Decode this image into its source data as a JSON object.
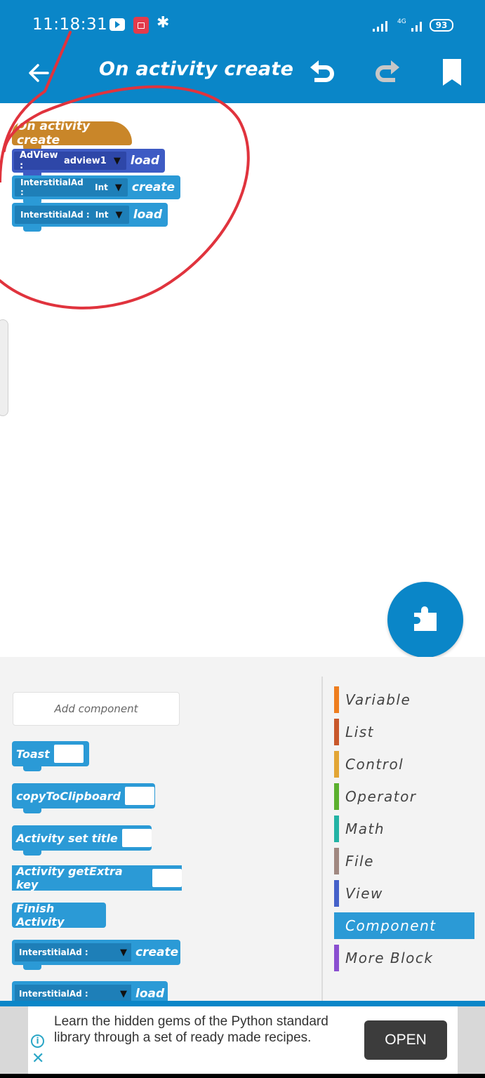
{
  "status_bar": {
    "time": "11:18:31",
    "network_label": "4G",
    "battery": "93",
    "icons": [
      "youtube-icon",
      "screen-record-icon",
      "gear-icon",
      "signal-icon",
      "signal-4g-icon",
      "battery-icon"
    ]
  },
  "app_bar": {
    "title": "On activity create",
    "back_icon": "arrow-left-icon",
    "undo_icon": "undo-icon",
    "redo_icon": "redo-icon",
    "bookmark_icon": "bookmark-icon"
  },
  "canvas": {
    "event_block": "On activity create",
    "blocks": [
      {
        "type": "AdView :",
        "selected": "adview1",
        "verb": "load",
        "color": "#3e5bc4"
      },
      {
        "type": "InterstitialAd :",
        "selected": "Int",
        "verb": "create",
        "color": "#2b9ad6"
      },
      {
        "type": "InterstitialAd :",
        "selected": "Int",
        "verb": "load",
        "color": "#2b9ad6"
      }
    ],
    "fab_icon": "puzzle-piece-icon"
  },
  "palette": {
    "add_component_label": "Add component",
    "blocks": [
      {
        "label": "Toast"
      },
      {
        "label": "copyToClipboard"
      },
      {
        "label": "Activity set title"
      },
      {
        "label": "Activity getExtra key"
      },
      {
        "label": "Finish Activity"
      },
      {
        "label": "InterstitialAd :",
        "verb": "create"
      },
      {
        "label": "InterstitialAd :",
        "verb": "load"
      }
    ],
    "categories": [
      {
        "label": "Variable",
        "color": "#ee7d1e"
      },
      {
        "label": "List",
        "color": "#c8572a"
      },
      {
        "label": "Control",
        "color": "#e2a535"
      },
      {
        "label": "Operator",
        "color": "#5bb02e"
      },
      {
        "label": "Math",
        "color": "#23b3a4"
      },
      {
        "label": "File",
        "color": "#a08880"
      },
      {
        "label": "View",
        "color": "#4561c9"
      },
      {
        "label": "Component",
        "color": "#2b9ad6",
        "active": true
      },
      {
        "label": "More Block",
        "color": "#8a4fd0"
      }
    ]
  },
  "ad": {
    "text": "Learn the hidden gems of the Python standard library through a set of ready made recipes.",
    "button": "OPEN",
    "info_icon": "info-icon",
    "close_icon": "close-icon"
  },
  "colors": {
    "primary": "#0a86c8",
    "annotation": "#e0333d"
  }
}
